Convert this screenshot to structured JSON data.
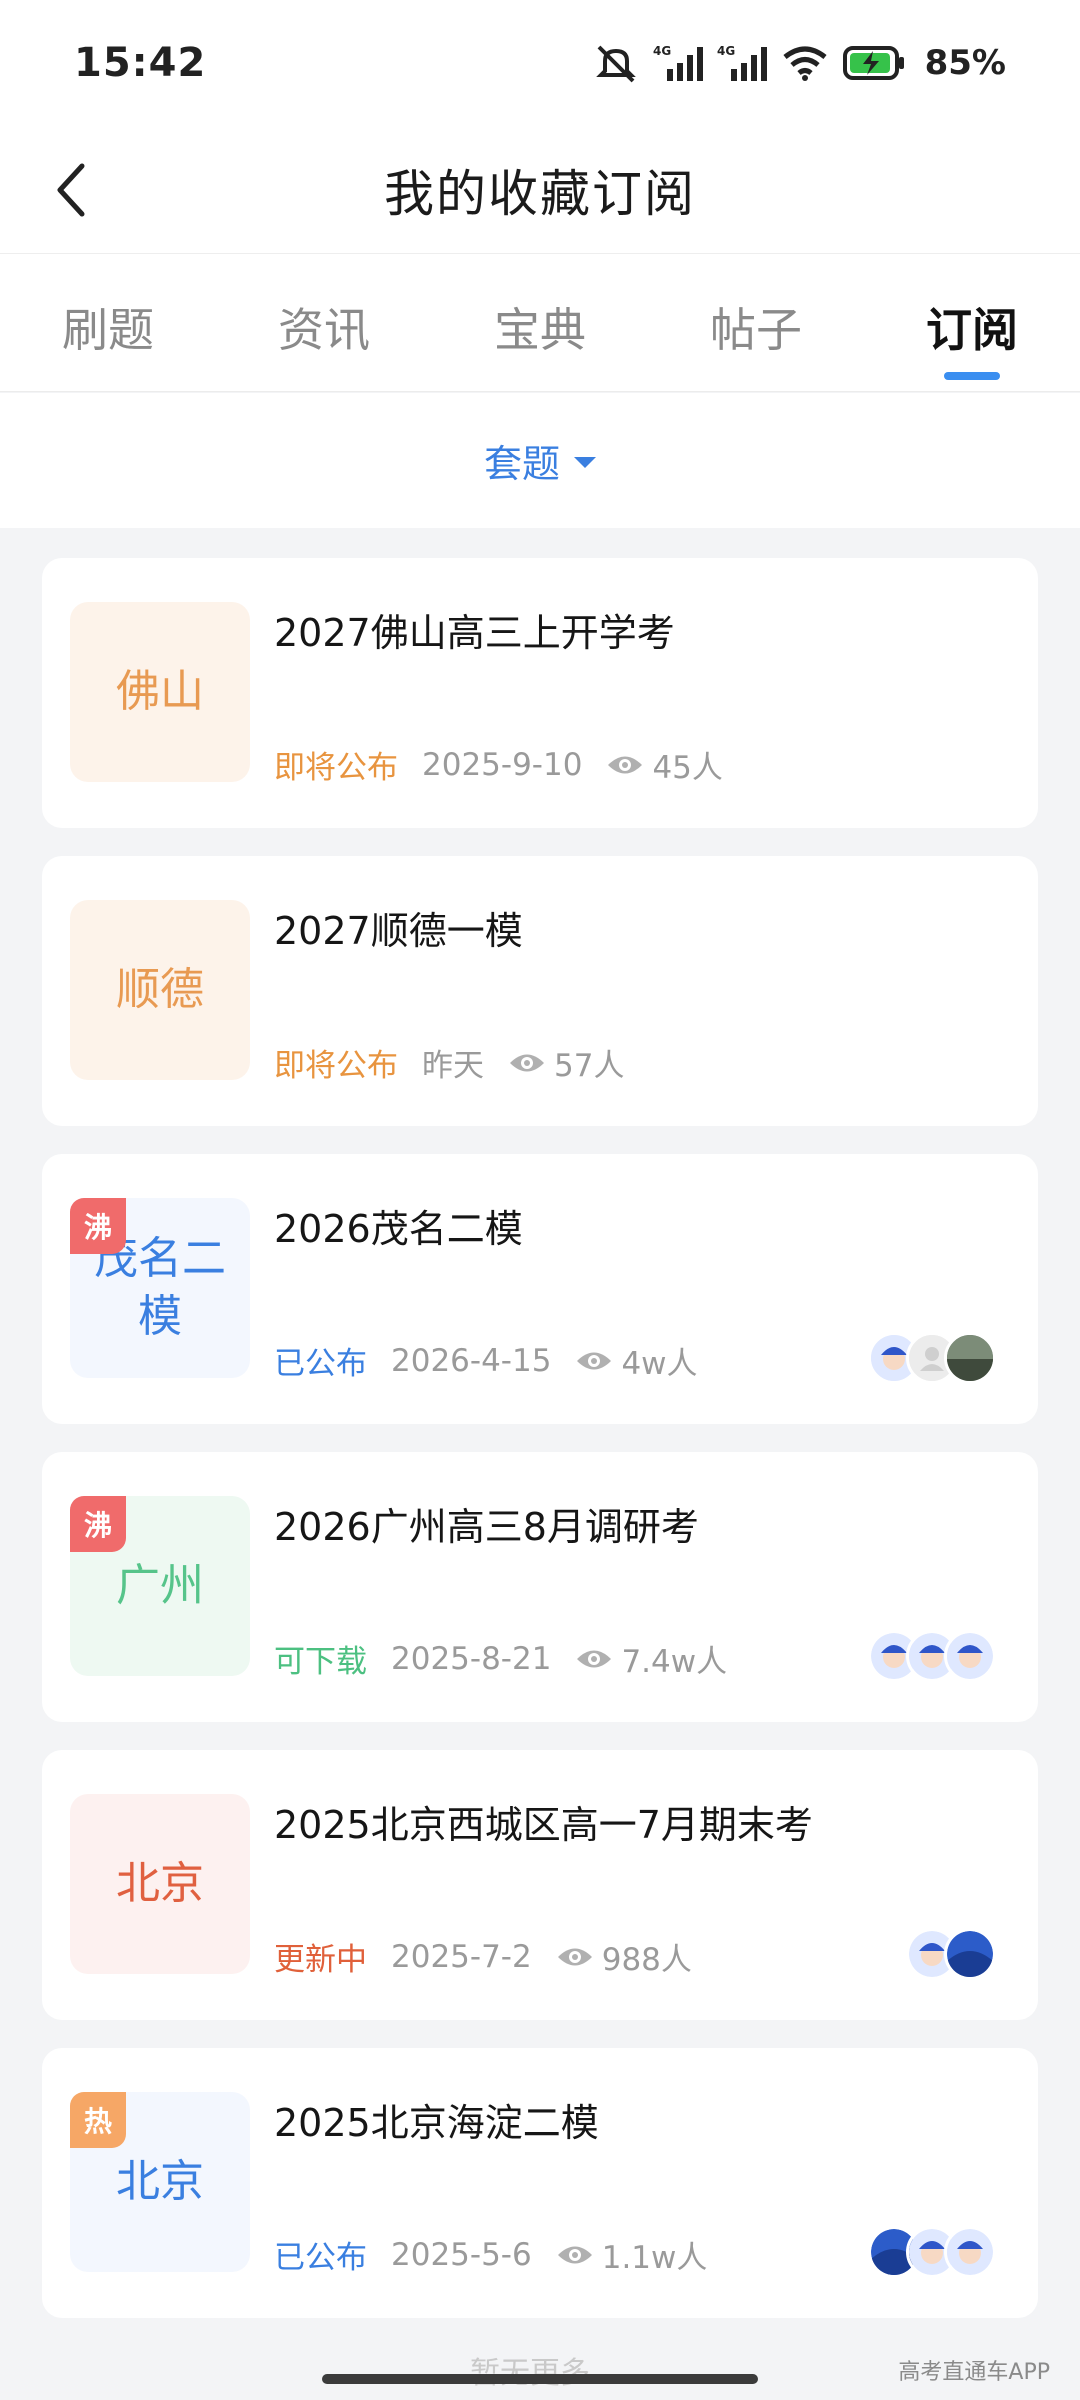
{
  "status_bar": {
    "time": "15:42",
    "battery": "85%"
  },
  "header": {
    "title": "我的收藏订阅"
  },
  "tabs": [
    {
      "label": "刷题"
    },
    {
      "label": "资讯"
    },
    {
      "label": "宝典"
    },
    {
      "label": "帖子"
    },
    {
      "label": "订阅"
    }
  ],
  "filter": {
    "label": "套题"
  },
  "cards": [
    {
      "title": "2027佛山高三上开学考",
      "thumb": "佛山",
      "status": "即将公布",
      "date": "2025-9-10",
      "views": "45人"
    },
    {
      "title": "2027顺德一模",
      "thumb": "顺德",
      "status": "即将公布",
      "date": "昨天",
      "views": "57人"
    },
    {
      "title": "2026茂名二模",
      "thumb": "茂名二模",
      "badge": "沸",
      "status": "已公布",
      "date": "2026-4-15",
      "views": "4w人"
    },
    {
      "title": "2026广州高三8月调研考",
      "thumb": "广州",
      "badge": "沸",
      "status": "可下载",
      "date": "2025-8-21",
      "views": "7.4w人"
    },
    {
      "title": "2025北京西城区高一7月期末考",
      "thumb": "北京",
      "status": "更新中",
      "date": "2025-7-2",
      "views": "988人"
    },
    {
      "title": "2025北京海淀二模",
      "thumb": "北京",
      "badge": "热",
      "status": "已公布",
      "date": "2025-5-6",
      "views": "1.1w人"
    }
  ],
  "footer": {
    "peek": "暂无更多",
    "watermark": "高考直通车APP"
  }
}
